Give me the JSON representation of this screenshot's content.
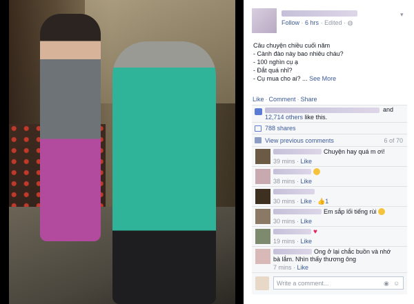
{
  "post": {
    "follow_label": "Follow",
    "time_label": "6 hrs",
    "edited_label": "Edited",
    "text_lines": [
      "Câu chuyện chiều cuối năm",
      "- Cành đào này bao nhiêu cháu?",
      "- 100 nghìn cụ ạ",
      "- Đắt quá nhỉ?",
      "- Cụ mua cho ai? ..."
    ],
    "see_more_label": "See More"
  },
  "actions": {
    "like": "Like",
    "comment": "Comment",
    "share": "Share"
  },
  "ufi": {
    "likes_and": "and",
    "likes_others_count": "12,714 others",
    "likes_suffix": "like this.",
    "shares_label": "788 shares",
    "view_previous_label": "View previous comments",
    "comment_count_label": "6 of 70",
    "comments": [
      {
        "text": "Chuyện hay quá m ơi!",
        "time": "39 mins",
        "like": "Like",
        "reaction": ""
      },
      {
        "text": "",
        "time": "38 mins",
        "like": "Like",
        "reaction": "smile"
      },
      {
        "text": "",
        "time": "30 mins",
        "like": "Like",
        "reaction": "",
        "likes_count": "1"
      },
      {
        "text": "Em sắp lối tiếng rùi",
        "time": "30 mins",
        "like": "Like",
        "reaction": "laugh"
      },
      {
        "text": "",
        "time": "19 mins",
        "like": "Like",
        "reaction": "heart"
      },
      {
        "text_line1": "Ong ở lại chắc buồn và nhớ",
        "text_line2": "bà lắm. Nhìn thấy thương ông",
        "time": "7 mins",
        "like": "Like"
      }
    ],
    "composer_placeholder": "Write a comment..."
  },
  "colors": {
    "link": "#3b5998",
    "meta": "#9197a3",
    "ufi_bg": "#f6f7f9"
  }
}
